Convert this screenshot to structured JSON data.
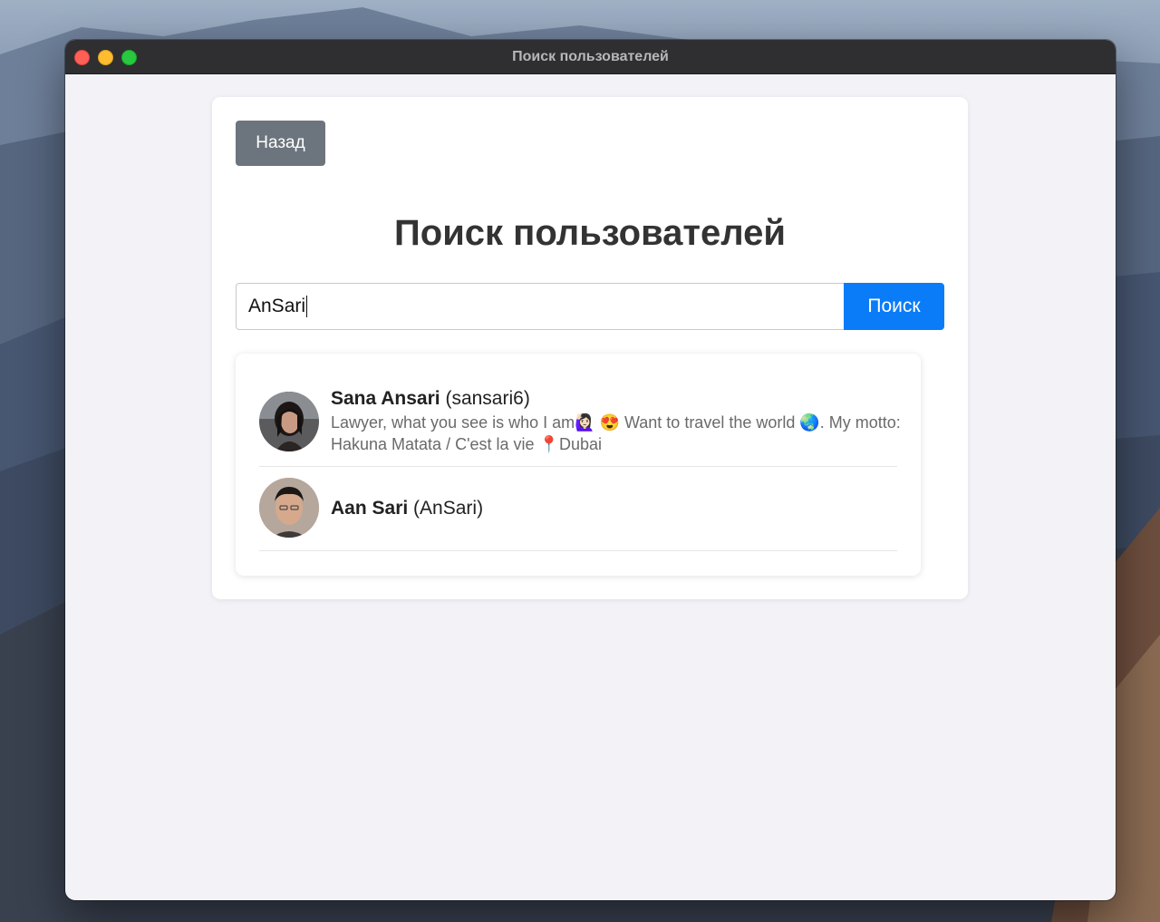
{
  "window": {
    "title": "Поиск пользователей"
  },
  "page": {
    "back_label": "Назад",
    "heading": "Поиск пользователей",
    "search": {
      "value": "AnSari",
      "button_label": "Поиск"
    }
  },
  "results": [
    {
      "name": "Sana Ansari",
      "username": "(sansari6)",
      "bio": "Lawyer, what you see is who I am🙋🏻‍♀️ 😍 Want to travel the world 🌏. My motto: Hakuna Matata / C'est la vie 📍Dubai"
    },
    {
      "name": "Aan Sari",
      "username": "(AnSari)",
      "bio": ""
    }
  ],
  "colors": {
    "back_button": "#6c757d",
    "search_button": "#0a7cf8",
    "heading": "#333333"
  },
  "icons": [
    "close-traffic-light",
    "minimize-traffic-light",
    "maximize-traffic-light",
    "avatar-photo"
  ]
}
